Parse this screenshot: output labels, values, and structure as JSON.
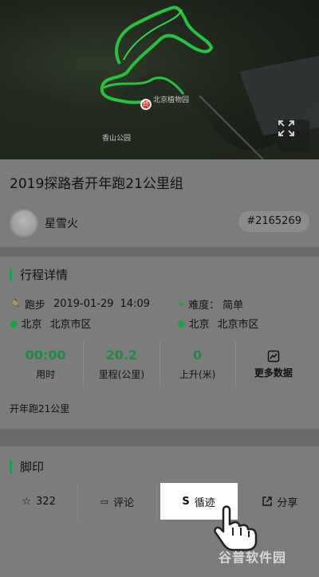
{
  "map": {
    "labels": [
      "北京植物园",
      "香山公园"
    ],
    "track_color": "#27c23f",
    "start_marker_label": "终"
  },
  "route": {
    "title": "2019探路者开年跑21公里组",
    "user_name": "星雪火",
    "route_id": "#2165269"
  },
  "trip": {
    "heading": "行程详情",
    "sport_type": "跑步",
    "date": "2019-01-29",
    "time": "14:09",
    "difficulty_label": "难度：",
    "difficulty": "简单",
    "start_city": "北京",
    "start_area": "北京市区",
    "end_city": "北京",
    "end_area": "北京市区",
    "stats": [
      {
        "value": "00:00",
        "label": "用时"
      },
      {
        "value": "20.2",
        "label": "里程(公里)"
      },
      {
        "value": "0",
        "label": "上升(米)"
      }
    ],
    "more_data_label": "更多数据",
    "description": "开年跑21公里"
  },
  "footprint": {
    "heading": "脚印",
    "actions": [
      {
        "label": "322",
        "icon": "star-icon"
      },
      {
        "label": "评论",
        "icon": "comment-icon"
      },
      {
        "label": "循迹",
        "icon": "route-s-icon"
      },
      {
        "label": "分享",
        "icon": "share-icon"
      }
    ]
  },
  "watermark": "谷普软件园",
  "colors": {
    "accent": "#1f9e4a",
    "stat_value": "#1f8a43"
  }
}
